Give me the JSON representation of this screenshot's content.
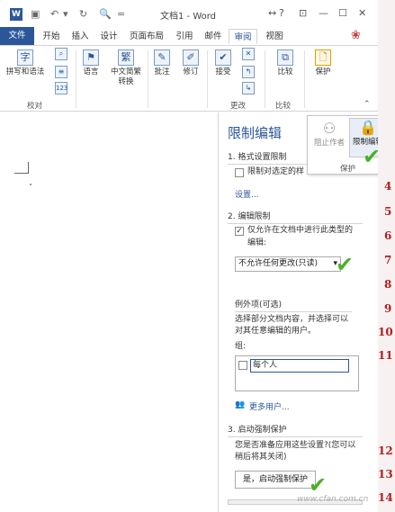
{
  "titlebar": {
    "app_logo": "W",
    "title": "文档1 - Word",
    "help": "?",
    "undo_icon": "undo-icon",
    "redo_icon": "redo-icon"
  },
  "tabs": [
    "文件",
    "开始",
    "插入",
    "设计",
    "页面布局",
    "引用",
    "邮件",
    "审阅",
    "视图"
  ],
  "active_tab": "审阅",
  "ribbon": {
    "proofing": {
      "spelling": "拼写和语法",
      "group": "校对"
    },
    "language": "语言",
    "chinese_convert": [
      "中文简繁",
      "转换"
    ],
    "comment": "批注",
    "track": "修订",
    "accept": "接受",
    "changes_group": "更改",
    "compare": "比较",
    "compare_group": "比较",
    "protect": "保护"
  },
  "protect_popup": {
    "block_authors": "阻止作者",
    "restrict_editing": "限制编辑",
    "group": "保护"
  },
  "pane": {
    "title": "限制编辑",
    "section1": {
      "heading": "1. 格式设置限制",
      "checkbox_label": "限制对选定的样",
      "settings_link": "设置..."
    },
    "section2": {
      "heading": "2. 编辑限制",
      "checkbox_label_line1": "仅允许在文档中进行此类型的",
      "checkbox_label_line2": "编辑:",
      "select_value": "不允许任何更改(只读)",
      "exceptions_heading": "例外项(可选)",
      "exceptions_desc_line1": "选择部分文档内容，并选择可以",
      "exceptions_desc_line2": "对其任意编辑的用户。",
      "group_label": "组:",
      "group_item": "每个人",
      "more_users": "更多用户..."
    },
    "section3": {
      "heading": "3. 启动强制保护",
      "question_line1": "您是否准备应用这些设置?(您可以",
      "question_line2": "稍后将其关闭)",
      "start_button": "是，启动强制保护"
    }
  },
  "right_strip": {
    "line_numbers": [
      "4",
      "5",
      "6",
      "7",
      "8",
      "9",
      "10",
      "11",
      "12",
      "13",
      "14"
    ]
  },
  "watermark": "www.cfan.com.cn",
  "colors": {
    "accent": "#2b579a",
    "check": "#4caf28",
    "line_numbers": "#b02020"
  }
}
